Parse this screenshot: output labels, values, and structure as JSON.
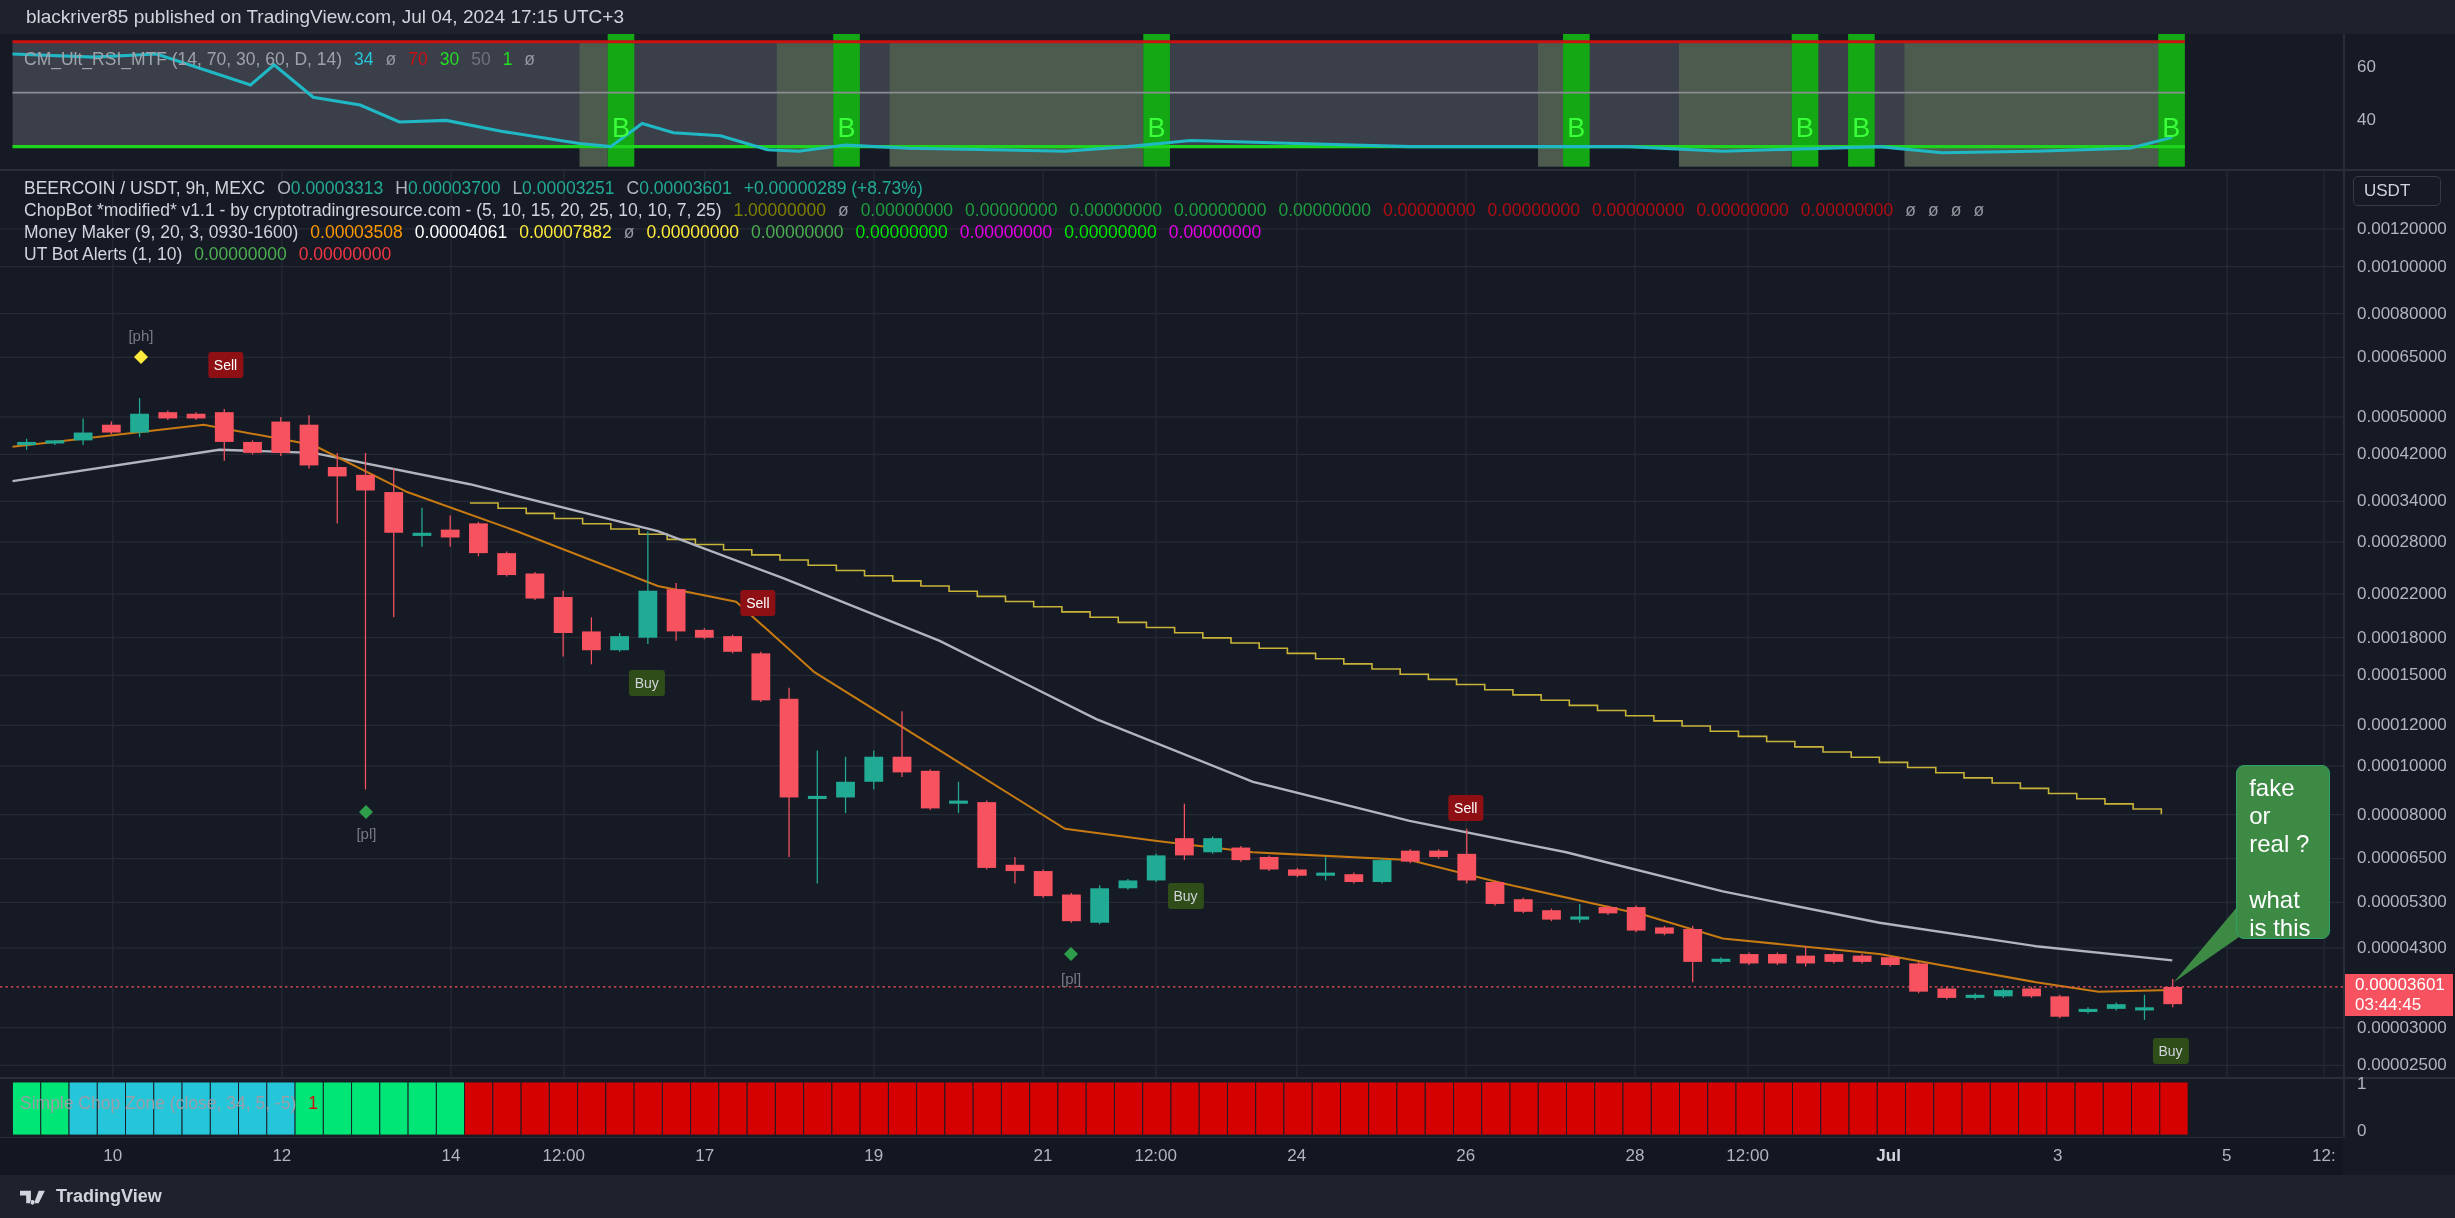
{
  "header": {
    "publisher": "blackriver85 published on TradingView.com, Jul 04, 2024 17:15 UTC+3"
  },
  "rsi_pane": {
    "legend": {
      "name": "CM_Ult_RSI_MTF (14, 70, 30, 60, D, 14)",
      "values": [
        {
          "text": "34",
          "color": "#26c6da"
        },
        {
          "text": "ø",
          "color": "#9598a1"
        },
        {
          "text": "70",
          "color": "#cc1111"
        },
        {
          "text": "30",
          "color": "#22dd22"
        },
        {
          "text": "50",
          "color": "#6f7380"
        },
        {
          "text": "1",
          "color": "#22dd22"
        },
        {
          "text": "ø",
          "color": "#9598a1"
        }
      ]
    },
    "signals": [
      "B",
      "B",
      "B",
      "B",
      "B",
      "B",
      "B"
    ],
    "axis": [
      "60",
      "40"
    ]
  },
  "main_pane": {
    "legends": [
      {
        "name": "BEERCOIN / USDT, 9h, MEXC",
        "values": [
          {
            "label": "O",
            "text": "0.00003313",
            "color": "#22ab94"
          },
          {
            "label": "H",
            "text": "0.00003700",
            "color": "#22ab94"
          },
          {
            "label": "L",
            "text": "0.00003251",
            "color": "#22ab94"
          },
          {
            "label": "C",
            "text": "0.00003601",
            "color": "#22ab94"
          },
          {
            "text": "+0.00000289 (+8.73%)",
            "color": "#22ab94"
          }
        ]
      },
      {
        "name": "ChopBot *modified* v1.1 - by cryptotradingresource.com - (5, 10, 15, 20, 25, 10, 10, 7, 25)",
        "values": [
          {
            "text": "1.00000000",
            "color": "#808000"
          },
          {
            "text": "ø",
            "color": "#9598a1"
          },
          {
            "text": "0.00000000",
            "color": "#1e9e3e"
          },
          {
            "text": "0.00000000",
            "color": "#1e9e3e"
          },
          {
            "text": "0.00000000",
            "color": "#1e9e3e"
          },
          {
            "text": "0.00000000",
            "color": "#1e9e3e"
          },
          {
            "text": "0.00000000",
            "color": "#1e9e3e"
          },
          {
            "text": "0.00000000",
            "color": "#b00d12"
          },
          {
            "text": "0.00000000",
            "color": "#b00d12"
          },
          {
            "text": "0.00000000",
            "color": "#b00d12"
          },
          {
            "text": "0.00000000",
            "color": "#b00d12"
          },
          {
            "text": "0.00000000",
            "color": "#b00d12"
          },
          {
            "text": "ø",
            "color": "#9598a1"
          },
          {
            "text": "ø",
            "color": "#9598a1"
          },
          {
            "text": "ø",
            "color": "#9598a1"
          },
          {
            "text": "ø",
            "color": "#9598a1"
          }
        ]
      },
      {
        "name": "Money Maker (9, 20, 3, 0930-1600)",
        "values": [
          {
            "text": "0.00003508",
            "color": "#ff9800"
          },
          {
            "text": "0.00004061",
            "color": "#ffffff"
          },
          {
            "text": "0.00007882",
            "color": "#ffeb3b"
          },
          {
            "text": "ø",
            "color": "#9598a1"
          },
          {
            "text": "0.00000000",
            "color": "#ffeb3b"
          },
          {
            "text": "0.00000000",
            "color": "#4caf50"
          },
          {
            "text": "0.00000000",
            "color": "#00e600"
          },
          {
            "text": "0.00000000",
            "color": "#e600e6"
          },
          {
            "text": "0.00000000",
            "color": "#00e600"
          },
          {
            "text": "0.00000000",
            "color": "#e600e6"
          }
        ]
      },
      {
        "name": "UT Bot Alerts (1, 10)",
        "values": [
          {
            "text": "0.00000000",
            "color": "#4caf50"
          },
          {
            "text": "0.00000000",
            "color": "#f23645"
          }
        ]
      }
    ],
    "markers": [
      {
        "kind": "pivot_high",
        "text": "[ph]"
      },
      {
        "kind": "pivot_low",
        "text": "[pl]"
      },
      {
        "kind": "pivot_low",
        "text": "[pl]"
      }
    ],
    "signals": [
      {
        "kind": "sell",
        "text": "Sell"
      },
      {
        "kind": "buy",
        "text": "Buy"
      },
      {
        "kind": "sell",
        "text": "Sell"
      },
      {
        "kind": "buy",
        "text": "Buy"
      },
      {
        "kind": "sell",
        "text": "Sell"
      },
      {
        "kind": "buy",
        "text": "Buy"
      }
    ],
    "callout": {
      "paragraphs": [
        "fake or real ?",
        "what is this"
      ]
    },
    "price_axis": {
      "unit": "USDT",
      "ticks": [
        "0.00120000",
        "0.00100000",
        "0.00080000",
        "0.00065000",
        "0.00050000",
        "0.00042000",
        "0.00034000",
        "0.00028000",
        "0.00022000",
        "0.00018000",
        "0.00015000",
        "0.00012000",
        "0.00010000",
        "0.00008000",
        "0.00006500",
        "0.00005300",
        "0.00004300",
        "0.00003000",
        "0.00002500"
      ],
      "last_price": "0.00003601",
      "countdown": "03:44:45"
    }
  },
  "chop_pane": {
    "legend": {
      "name": "Simple Chop Zone (close, 34, 5, -5)",
      "value": {
        "text": "1",
        "color": "#cc1111"
      }
    },
    "bars": [
      {
        "color": "#00e676"
      },
      {
        "color": "#00e676"
      },
      {
        "color": "#26c6da"
      },
      {
        "color": "#26c6da"
      },
      {
        "color": "#26c6da"
      },
      {
        "color": "#26c6da"
      },
      {
        "color": "#26c6da"
      },
      {
        "color": "#26c6da"
      },
      {
        "color": "#26c6da"
      },
      {
        "color": "#26c6da"
      },
      {
        "color": "#00e676"
      },
      {
        "color": "#00e676"
      },
      {
        "color": "#00e676"
      },
      {
        "color": "#00e676"
      },
      {
        "color": "#00e676"
      },
      {
        "color": "#00e676"
      },
      {
        "color": "#d50000"
      },
      {
        "color": "#d50000"
      },
      {
        "color": "#d50000"
      },
      {
        "color": "#d50000"
      },
      {
        "color": "#d50000"
      },
      {
        "color": "#d50000"
      },
      {
        "color": "#d50000"
      },
      {
        "color": "#d50000"
      },
      {
        "color": "#d50000"
      },
      {
        "color": "#d50000"
      },
      {
        "color": "#d50000"
      },
      {
        "color": "#d50000"
      },
      {
        "color": "#d50000"
      },
      {
        "color": "#d50000"
      },
      {
        "color": "#d50000"
      },
      {
        "color": "#d50000"
      },
      {
        "color": "#d50000"
      },
      {
        "color": "#d50000"
      },
      {
        "color": "#d50000"
      },
      {
        "color": "#d50000"
      },
      {
        "color": "#d50000"
      },
      {
        "color": "#d50000"
      },
      {
        "color": "#d50000"
      },
      {
        "color": "#d50000"
      },
      {
        "color": "#d50000"
      },
      {
        "color": "#d50000"
      },
      {
        "color": "#d50000"
      },
      {
        "color": "#d50000"
      },
      {
        "color": "#d50000"
      },
      {
        "color": "#d50000"
      },
      {
        "color": "#d50000"
      },
      {
        "color": "#d50000"
      },
      {
        "color": "#d50000"
      },
      {
        "color": "#d50000"
      },
      {
        "color": "#d50000"
      },
      {
        "color": "#d50000"
      },
      {
        "color": "#d50000"
      },
      {
        "color": "#d50000"
      },
      {
        "color": "#d50000"
      },
      {
        "color": "#d50000"
      },
      {
        "color": "#d50000"
      },
      {
        "color": "#d50000"
      },
      {
        "color": "#d50000"
      },
      {
        "color": "#d50000"
      },
      {
        "color": "#d50000"
      },
      {
        "color": "#d50000"
      },
      {
        "color": "#d50000"
      },
      {
        "color": "#d50000"
      },
      {
        "color": "#d50000"
      },
      {
        "color": "#d50000"
      },
      {
        "color": "#d50000"
      },
      {
        "color": "#d50000"
      },
      {
        "color": "#d50000"
      },
      {
        "color": "#d50000"
      },
      {
        "color": "#d50000"
      },
      {
        "color": "#d50000"
      },
      {
        "color": "#d50000"
      },
      {
        "color": "#d50000"
      },
      {
        "color": "#d50000"
      },
      {
        "color": "#d50000"
      },
      {
        "color": "#d50000"
      }
    ],
    "axis": [
      "1",
      "0"
    ]
  },
  "time_axis": [
    {
      "text": "10",
      "kind": "day"
    },
    {
      "text": "12",
      "kind": "day"
    },
    {
      "text": "14",
      "kind": "day"
    },
    {
      "text": "12:00",
      "kind": "time"
    },
    {
      "text": "17",
      "kind": "day"
    },
    {
      "text": "19",
      "kind": "day"
    },
    {
      "text": "21",
      "kind": "day"
    },
    {
      "text": "12:00",
      "kind": "time"
    },
    {
      "text": "24",
      "kind": "day"
    },
    {
      "text": "26",
      "kind": "day"
    },
    {
      "text": "28",
      "kind": "day"
    },
    {
      "text": "12:00",
      "kind": "time"
    },
    {
      "text": "Jul",
      "kind": "month"
    },
    {
      "text": "3",
      "kind": "day"
    },
    {
      "text": "5",
      "kind": "day"
    },
    {
      "text": "12:",
      "kind": "time"
    }
  ],
  "footer": {
    "brand": "TradingView"
  }
}
